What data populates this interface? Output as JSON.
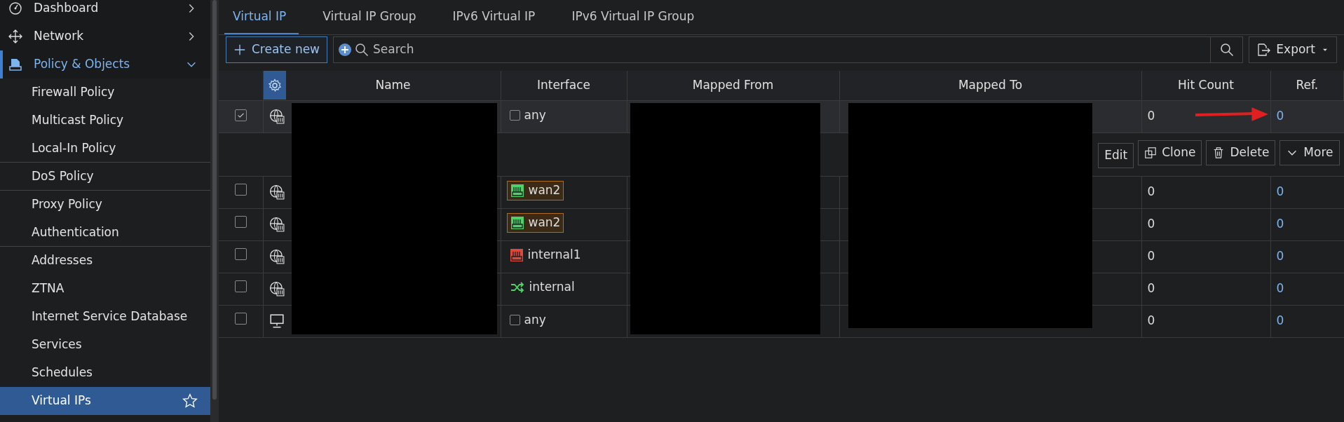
{
  "sidebar": {
    "items": [
      {
        "label": "Dashboard",
        "expanded": false,
        "selected": false
      },
      {
        "label": "Network",
        "expanded": false,
        "selected": false
      },
      {
        "label": "Policy & Objects",
        "expanded": true,
        "selected": false,
        "children": [
          {
            "label": "Firewall Policy",
            "selected": false,
            "divider": false
          },
          {
            "label": "Multicast Policy",
            "selected": false,
            "divider": false
          },
          {
            "label": "Local-In Policy",
            "selected": false,
            "divider": true
          },
          {
            "label": "DoS Policy",
            "selected": false,
            "divider": true
          },
          {
            "label": "Proxy Policy",
            "selected": false,
            "divider": false
          },
          {
            "label": "Authentication",
            "selected": false,
            "divider": true
          },
          {
            "label": "Addresses",
            "selected": false,
            "divider": false
          },
          {
            "label": "ZTNA",
            "selected": false,
            "divider": false
          },
          {
            "label": "Internet Service Database",
            "selected": false,
            "divider": false
          },
          {
            "label": "Services",
            "selected": false,
            "divider": false
          },
          {
            "label": "Schedules",
            "selected": false,
            "divider": false
          },
          {
            "label": "Virtual IPs",
            "selected": true,
            "divider": false
          }
        ]
      }
    ]
  },
  "tabs": [
    {
      "label": "Virtual IP",
      "selected": true
    },
    {
      "label": "Virtual IP Group",
      "selected": false
    },
    {
      "label": "IPv6 Virtual IP",
      "selected": false
    },
    {
      "label": "IPv6 Virtual IP Group",
      "selected": false
    }
  ],
  "toolbar": {
    "create_button": "Create new",
    "search": {
      "placeholder": "Search"
    },
    "export_button": "Export"
  },
  "table": {
    "columns": [
      "Name",
      "Interface",
      "Mapped From",
      "Mapped To",
      "Hit Count",
      "Ref."
    ],
    "rows": [
      {
        "selected": true,
        "kind": "globe",
        "interface": {
          "kind": "any",
          "label": "any"
        },
        "hit_count": "0",
        "ref": "0"
      },
      {
        "selected": false,
        "kind": "globe",
        "interface": {
          "kind": "port",
          "label": "wan2",
          "color": "#4fd16a",
          "highlighted": true
        },
        "hit_count": "0",
        "ref": "0"
      },
      {
        "selected": false,
        "kind": "globe",
        "interface": {
          "kind": "port",
          "label": "wan2",
          "color": "#4fd16a",
          "highlighted": true
        },
        "hit_count": "0",
        "ref": "0"
      },
      {
        "selected": false,
        "kind": "globe",
        "interface": {
          "kind": "port",
          "label": "internal1",
          "color": "#d9493c",
          "highlighted": false
        },
        "hit_count": "0",
        "ref": "0"
      },
      {
        "selected": false,
        "kind": "globe",
        "interface": {
          "kind": "switch",
          "label": "internal"
        },
        "hit_count": "0",
        "ref": "0"
      },
      {
        "selected": false,
        "kind": "monitor",
        "interface": {
          "kind": "any",
          "label": "any"
        },
        "hit_count": "0",
        "ref": "0"
      }
    ],
    "row_actions": [
      "Edit",
      "Clone",
      "Delete",
      "More"
    ]
  }
}
